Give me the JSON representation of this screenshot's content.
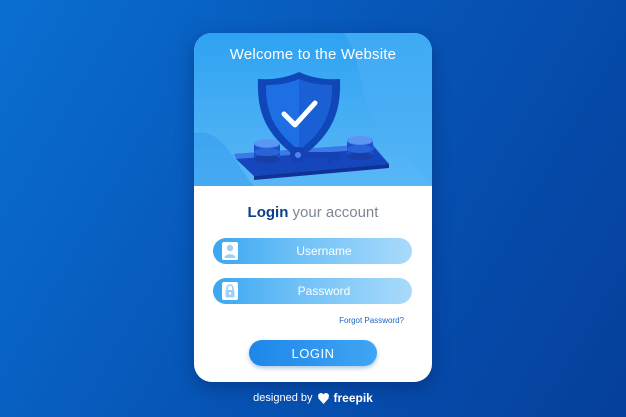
{
  "card": {
    "welcome": "Welcome to the Website",
    "login_title_strong": "Login",
    "login_title_rest": "your account",
    "username_placeholder": "Username",
    "password_placeholder": "Password",
    "forgot_password": "Forgot Password?",
    "login_button": "LOGIN"
  },
  "footer": {
    "designed_by": "designed by",
    "brand": "freepik",
    "brand_icon": "freepik-logo"
  },
  "colors": {
    "background": "#0757b8",
    "accent": "#2ea2f2",
    "title": "#0b3f88",
    "link": "#1a66c4"
  },
  "icons": [
    "shield-check-icon",
    "key-icon",
    "coin-stack-icon",
    "user-icon",
    "lock-icon"
  ]
}
